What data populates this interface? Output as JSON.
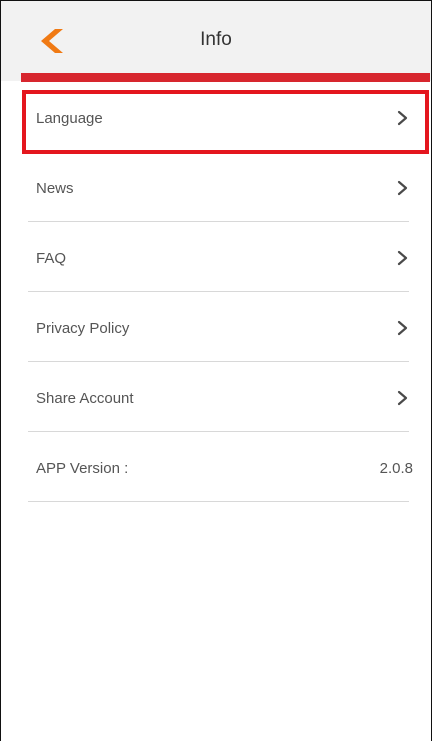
{
  "header": {
    "title": "Info",
    "back_icon": "chevron-left-icon",
    "accent_color": "#d7262e",
    "back_icon_color": "#f07a14"
  },
  "info_list": [
    {
      "label": "Language",
      "icon": "chevron-right-icon"
    },
    {
      "label": "News",
      "icon": "chevron-right-icon"
    },
    {
      "label": "FAQ",
      "icon": "chevron-right-icon"
    },
    {
      "label": "Privacy Policy",
      "icon": "chevron-right-icon"
    },
    {
      "label": "Share Account",
      "icon": "chevron-right-icon"
    }
  ],
  "app_version": {
    "label": "APP Version :",
    "value": "2.0.8"
  },
  "highlight_color": "#e4161e"
}
